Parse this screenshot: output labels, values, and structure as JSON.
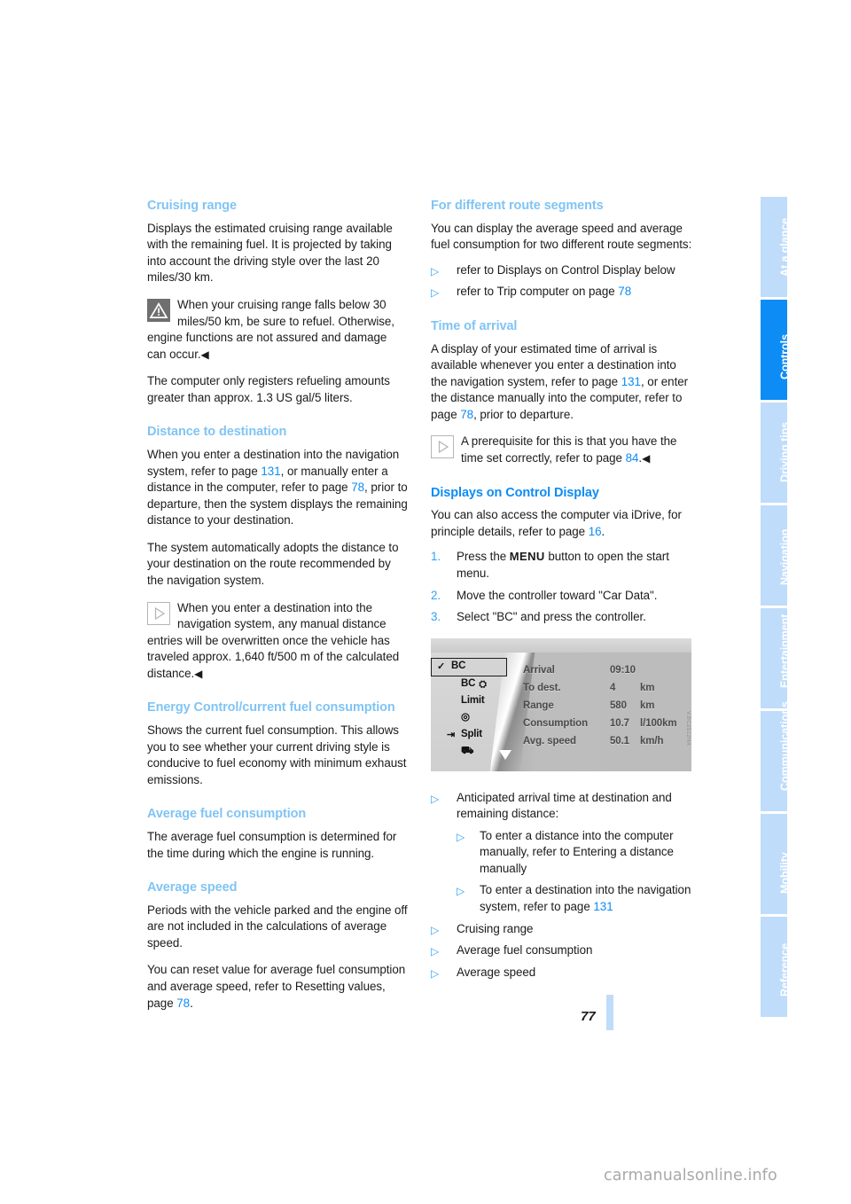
{
  "page": {
    "number": "77",
    "watermark": "carmanualsonline.info",
    "figure_code": "V.BC2512HA"
  },
  "left_column": {
    "sections": [
      {
        "heading": "Cruising range",
        "paragraphs": [
          "Displays the estimated cruising range available with the remaining fuel. It is projected by taking into account the driving style over the last 20 miles/30 km."
        ],
        "note": {
          "icon": "warning-triangle-icon",
          "text": "When your cruising range falls below 30 miles/50 km, be sure to refuel. Otherwise, engine functions are not assured and damage can occur.",
          "endmark": "◀"
        },
        "after_note": [
          "The computer only registers refueling amounts greater than approx. 1.3 US gal/5 liters."
        ]
      },
      {
        "heading": "Distance to destination",
        "paragraph_1_a": "When you enter a destination into the navigation system, refer to page ",
        "paragraph_1_ref1": "131",
        "paragraph_1_b": ", or manually enter a distance in the computer, refer to page ",
        "paragraph_1_ref2": "78",
        "paragraph_1_c": ", prior to departure, then the system displays the remaining distance to your destination.",
        "paragraph_2": "The system automatically adopts the distance to your destination on the route recommended by the navigation system.",
        "note": {
          "icon": "note-triangle-icon",
          "text": "When you enter a destination into the navigation system, any manual distance entries will be overwritten once the vehicle has traveled approx. 1,640 ft/500 m of the calculated distance.",
          "endmark": "◀"
        }
      },
      {
        "heading": "Energy Control/current fuel consumption",
        "paragraphs": [
          "Shows the current fuel consumption. This allows you to see whether your current driving style is conducive to fuel economy with minimum exhaust emissions."
        ]
      },
      {
        "heading": "Average fuel consumption",
        "paragraphs": [
          "The average fuel consumption is determined for the time during which the engine is running."
        ]
      },
      {
        "heading": "Average speed",
        "paragraphs": [
          "Periods with the vehicle parked and the engine off are not included in the calculations of average speed."
        ],
        "paragraph_ref_a": "You can reset value for average fuel consumption and average speed, refer to Resetting values, page ",
        "paragraph_ref_num": "78",
        "paragraph_ref_b": "."
      }
    ]
  },
  "right_column": {
    "sections": [
      {
        "heading": "For different route segments",
        "paragraph": "You can display the average speed and average fuel consumption for two different route segments:",
        "bullets": [
          {
            "text": "refer to Displays on Control Display below"
          },
          {
            "text_a": "refer to Trip computer on page ",
            "ref": "78"
          }
        ]
      },
      {
        "heading": "Time of arrival",
        "paragraph_a": "A display of your estimated time of arrival is available whenever you enter a destination into the navigation system, refer to page ",
        "ref1": "131",
        "paragraph_b": ", or enter the distance manually into the computer, refer to page ",
        "ref2": "78",
        "paragraph_c": ", prior to departure.",
        "note": {
          "icon": "note-triangle-icon",
          "text_a": "A prerequisite for this is that you have the time set correctly, refer to page ",
          "ref": "84",
          "text_b": ".",
          "endmark": "◀"
        }
      },
      {
        "heading": "Displays on Control Display",
        "heading_strong": true,
        "paragraph_a": "You can also access the computer via iDrive, for principle details, refer to page ",
        "ref": "16",
        "paragraph_b": ".",
        "steps": [
          {
            "num": "1.",
            "text_a": "Press the ",
            "bold": "MENU",
            "text_b": " button to open the start menu."
          },
          {
            "num": "2.",
            "text": "Move the controller toward \"Car Data\"."
          },
          {
            "num": "3.",
            "text": "Select \"BC\" and press the controller."
          }
        ],
        "after_bullets": [
          {
            "text": "Anticipated arrival time at destination and remaining distance:",
            "sub": [
              {
                "text": "To enter a distance into the computer manually, refer to Entering a distance manually"
              },
              {
                "text_a": "To enter a destination into the navigation system, refer to page ",
                "ref": "131"
              }
            ]
          },
          {
            "text": "Cruising range"
          },
          {
            "text": "Average fuel consumption"
          },
          {
            "text": "Average speed"
          }
        ]
      }
    ]
  },
  "control_display": {
    "menu_items": [
      {
        "lead": "✓",
        "label": "BC",
        "trail": "",
        "selected": true
      },
      {
        "lead": "",
        "label": "BC",
        "trail": "⛭",
        "selected": false
      },
      {
        "lead": "",
        "label": "Limit",
        "trail": "",
        "selected": false
      },
      {
        "lead": "",
        "label": "◎",
        "trail": "",
        "selected": false
      },
      {
        "lead": "⇥",
        "label": "Split",
        "trail": "",
        "selected": false
      },
      {
        "lead": "",
        "label": "⛟",
        "trail": "",
        "selected": false
      }
    ],
    "rows": [
      {
        "label": "Arrival",
        "value": "09:10",
        "unit": ""
      },
      {
        "label": "To dest.",
        "value": "4",
        "unit": "km"
      },
      {
        "label": "Range",
        "value": "580",
        "unit": "km"
      },
      {
        "label": "Consumption",
        "value": "10.7",
        "unit": "l/100km"
      },
      {
        "label": "Avg. speed",
        "value": "50.1",
        "unit": "km/h"
      }
    ]
  },
  "sidebar": {
    "tabs": [
      {
        "label": "At a glance",
        "active": false
      },
      {
        "label": "Controls",
        "active": true
      },
      {
        "label": "Driving tips",
        "active": false
      },
      {
        "label": "Navigation",
        "active": false
      },
      {
        "label": "Entertainment",
        "active": false
      },
      {
        "label": "Communications",
        "active": false
      },
      {
        "label": "Mobility",
        "active": false
      },
      {
        "label": "Reference",
        "active": false
      }
    ]
  },
  "colors": {
    "heading_light": "#80c4f4",
    "heading_strong": "#0d8cf5",
    "tab_inactive": "#bfdcfb",
    "tab_active": "#0d8cf5",
    "page_ref": "#0d8cf5"
  }
}
